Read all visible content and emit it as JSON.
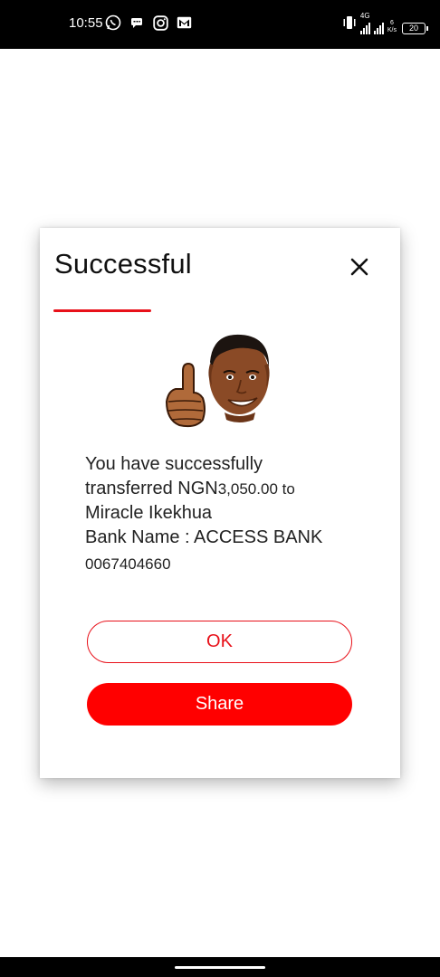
{
  "status_bar": {
    "time": "10:55",
    "network": "4G",
    "speed_value": "6",
    "speed_unit": "K/s",
    "battery": "20"
  },
  "dialog": {
    "title": "Successful",
    "message": {
      "line1": "You have successfully",
      "line2_prefix": "transferred NGN",
      "amount": "3,050.00",
      "line2_suffix": " to",
      "recipient": "Miracle Ikekhua",
      "bank_line": "Bank Name : ACCESS BANK",
      "account_number": "0067404660"
    },
    "ok_label": "OK",
    "share_label": "Share"
  },
  "colors": {
    "accent": "#e8111a",
    "share_bg": "#ff0000"
  },
  "icons": [
    "whatsapp-icon",
    "message-icon",
    "instagram-icon",
    "gmail-icon",
    "vibrate-icon",
    "signal-icon",
    "battery-icon",
    "close-icon",
    "thumbs-up-avatar"
  ]
}
